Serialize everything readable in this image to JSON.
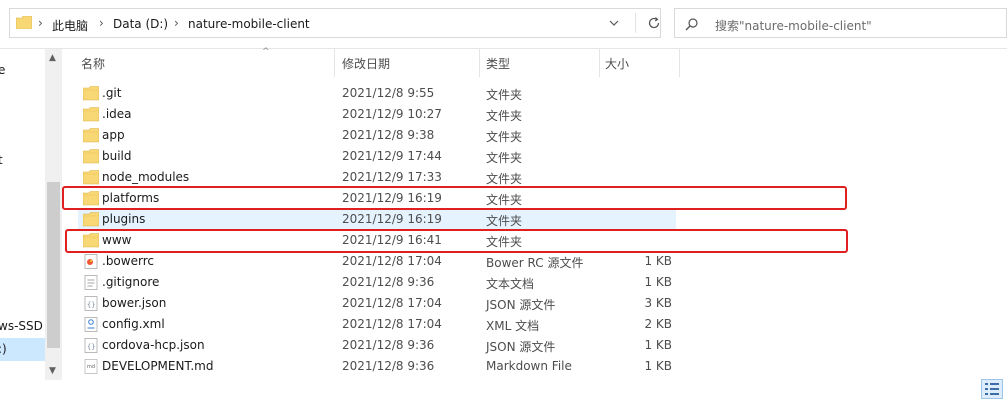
{
  "address_bar": {
    "crumbs": [
      "此电脑",
      "Data (D:)",
      "nature-mobile-client"
    ],
    "separator": "›"
  },
  "search": {
    "placeholder": "搜索\"nature-mobile-client\""
  },
  "nav_pane": {
    "items": [
      "e",
      "t",
      "ws-SSD",
      ":)"
    ]
  },
  "columns": {
    "name": "名称",
    "date": "修改日期",
    "type": "类型",
    "size": "大小"
  },
  "files": [
    {
      "name": ".git",
      "date": "2021/12/8 9:55",
      "type": "文件夹",
      "size": "",
      "icon": "folder-icon"
    },
    {
      "name": ".idea",
      "date": "2021/12/9 10:27",
      "type": "文件夹",
      "size": "",
      "icon": "folder-icon"
    },
    {
      "name": "app",
      "date": "2021/12/8 9:38",
      "type": "文件夹",
      "size": "",
      "icon": "folder-icon"
    },
    {
      "name": "build",
      "date": "2021/12/9 17:44",
      "type": "文件夹",
      "size": "",
      "icon": "folder-icon"
    },
    {
      "name": "node_modules",
      "date": "2021/12/9 17:33",
      "type": "文件夹",
      "size": "",
      "icon": "folder-icon"
    },
    {
      "name": "platforms",
      "date": "2021/12/9 16:19",
      "type": "文件夹",
      "size": "",
      "icon": "folder-icon"
    },
    {
      "name": "plugins",
      "date": "2021/12/9 16:19",
      "type": "文件夹",
      "size": "",
      "icon": "folder-icon"
    },
    {
      "name": "www",
      "date": "2021/12/9 16:41",
      "type": "文件夹",
      "size": "",
      "icon": "folder-icon"
    },
    {
      "name": ".bowerrc",
      "date": "2021/12/8 17:04",
      "type": "Bower RC 源文件",
      "size": "1 KB",
      "icon": "bower-file-icon"
    },
    {
      "name": ".gitignore",
      "date": "2021/12/8 9:36",
      "type": "文本文档",
      "size": "1 KB",
      "icon": "text-file-icon"
    },
    {
      "name": "bower.json",
      "date": "2021/12/8 17:04",
      "type": "JSON 源文件",
      "size": "3 KB",
      "icon": "json-file-icon"
    },
    {
      "name": "config.xml",
      "date": "2021/12/8 17:04",
      "type": "XML 文档",
      "size": "2 KB",
      "icon": "xml-file-icon"
    },
    {
      "name": "cordova-hcp.json",
      "date": "2021/12/8 9:36",
      "type": "JSON 源文件",
      "size": "1 KB",
      "icon": "json-file-icon"
    },
    {
      "name": "DEVELOPMENT.md",
      "date": "2021/12/8 9:36",
      "type": "Markdown File",
      "size": "1 KB",
      "icon": "markdown-file-icon"
    }
  ],
  "selected_row": "plugins",
  "highlighted_rows": [
    "platforms",
    "www"
  ],
  "colors": {
    "folder": "#f8d775",
    "selection": "#e5f3ff",
    "highlight_box": "#e02020"
  }
}
